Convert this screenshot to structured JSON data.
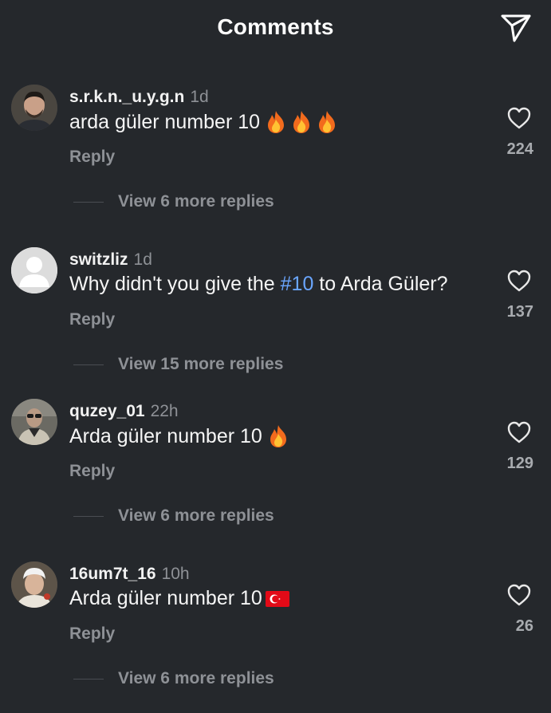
{
  "header": {
    "title": "Comments"
  },
  "comments": [
    {
      "username": "s.r.k.n._u.y.g.n",
      "time": "1d",
      "text": "arda güler number 10",
      "emoji": "fire-x3",
      "reply_label": "Reply",
      "likes": "224",
      "view_replies": "View 6 more replies"
    },
    {
      "username": "switzliz",
      "time": "1d",
      "text_before": "Why didn't you give the ",
      "hashtag": "#10",
      "text_after": " to Arda Güler?",
      "reply_label": "Reply",
      "likes": "137",
      "view_replies": "View 15 more replies"
    },
    {
      "username": "quzey_01",
      "time": "22h",
      "text": "Arda güler number 10",
      "emoji": "fire",
      "reply_label": "Reply",
      "likes": "129",
      "view_replies": "View 6 more replies"
    },
    {
      "username": "16um7t_16",
      "time": "10h",
      "text": "Arda güler number 10",
      "emoji": "turkey-flag",
      "reply_label": "Reply",
      "likes": "26",
      "view_replies": "View 6 more replies"
    }
  ],
  "colors": {
    "background": "#25282c",
    "secondary_text": "#8e9196",
    "hashtag": "#6aa6ff",
    "flag_red": "#e30a17"
  },
  "icons": {
    "share": "paper-plane-icon",
    "like": "heart-icon",
    "fire": "fire-emoji-icon",
    "flag": "turkey-flag-icon"
  }
}
